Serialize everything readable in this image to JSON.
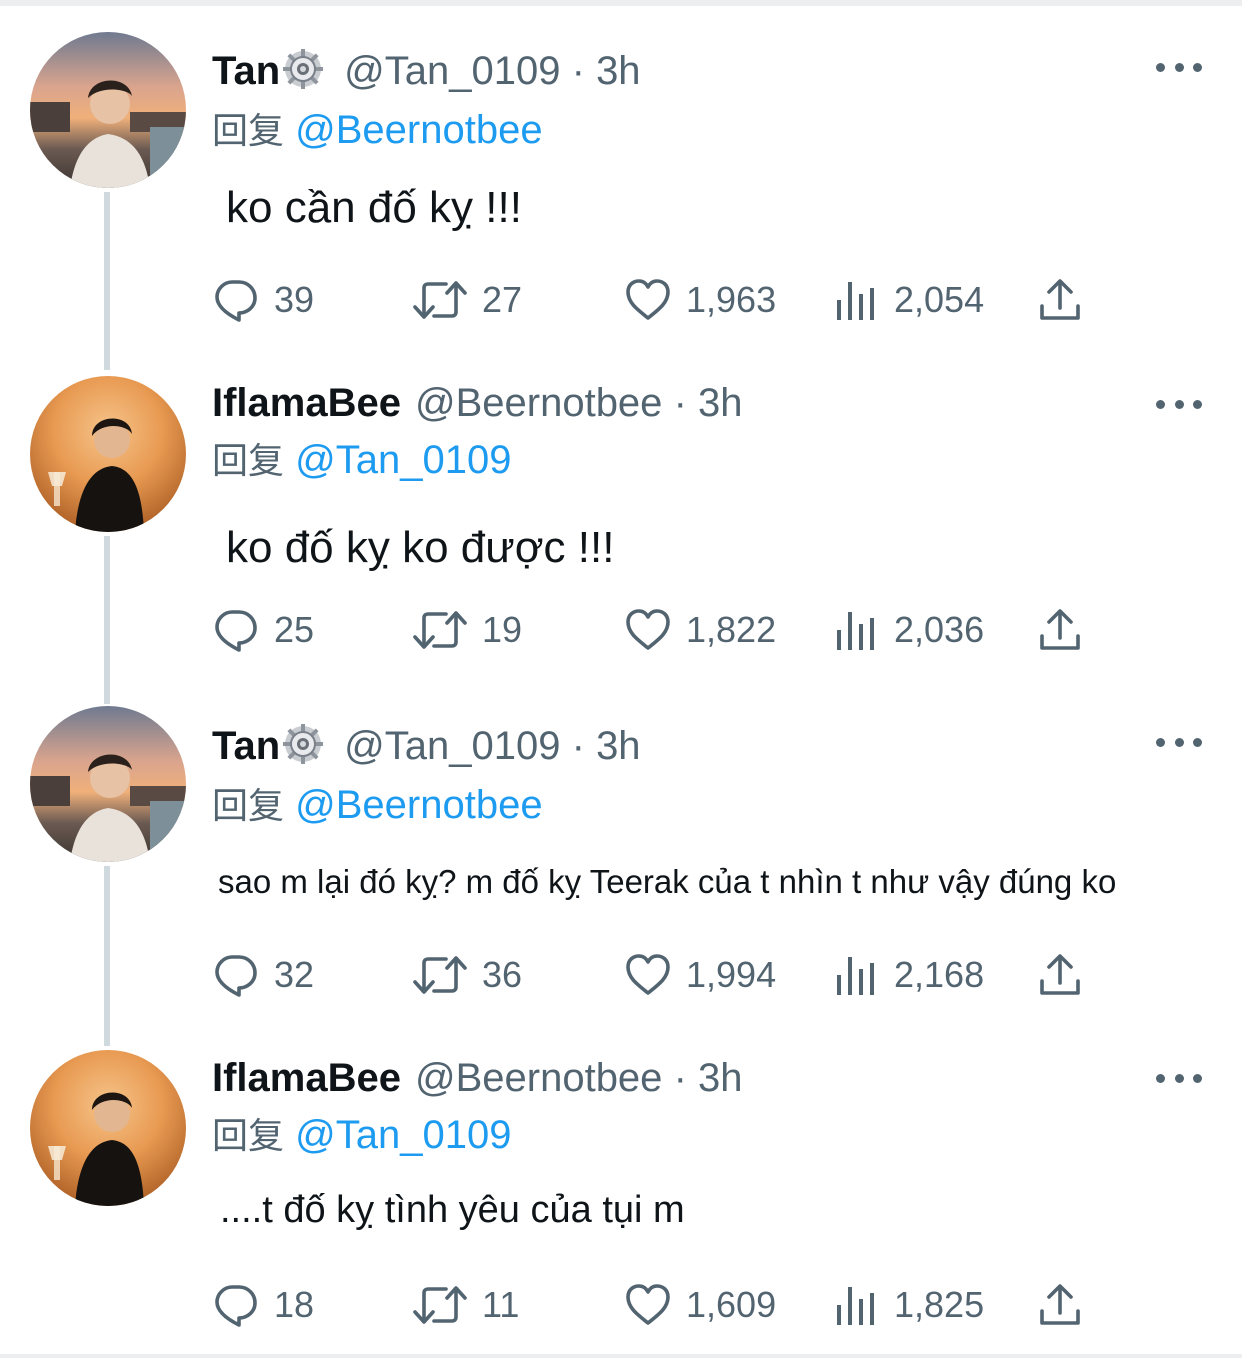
{
  "reply_prefix": "回复",
  "tweets": [
    {
      "name": "Tan",
      "verified_badge": "gear-badge",
      "handle": "@Tan_0109",
      "dot": "·",
      "time": "3h",
      "reply_to": "@Beernotbee",
      "text": "ko cần đố kỵ !!!",
      "stats": {
        "replies": "39",
        "retweets": "27",
        "likes": "1,963",
        "views": "2,054"
      }
    },
    {
      "name": "IflamaBee",
      "handle": "@Beernotbee",
      "dot": "·",
      "time": "3h",
      "reply_to": "@Tan_0109",
      "text": "ko đố kỵ ko được !!!",
      "stats": {
        "replies": "25",
        "retweets": "19",
        "likes": "1,822",
        "views": "2,036"
      }
    },
    {
      "name": "Tan",
      "verified_badge": "gear-badge",
      "handle": "@Tan_0109",
      "dot": "·",
      "time": "3h",
      "reply_to": "@Beernotbee",
      "text": "sao m lại đó kỵ? m đố kỵ Teerak của t nhìn t như vậy đúng ko",
      "stats": {
        "replies": "32",
        "retweets": "36",
        "likes": "1,994",
        "views": "2,168"
      }
    },
    {
      "name": "IflamaBee",
      "handle": "@Beernotbee",
      "dot": "·",
      "time": "3h",
      "reply_to": "@Tan_0109",
      "text": "....t đố kỵ tình yêu của tụi m",
      "stats": {
        "replies": "18",
        "retweets": "11",
        "likes": "1,609",
        "views": "1,825"
      }
    }
  ],
  "colors": {
    "text": "#0f1419",
    "secondary": "#536471",
    "link": "#1d9bf0",
    "thread_line": "#cfd9de"
  },
  "icons": [
    "reply-icon",
    "retweet-icon",
    "like-icon",
    "views-icon",
    "share-icon",
    "more-icon",
    "gear-badge-icon"
  ]
}
